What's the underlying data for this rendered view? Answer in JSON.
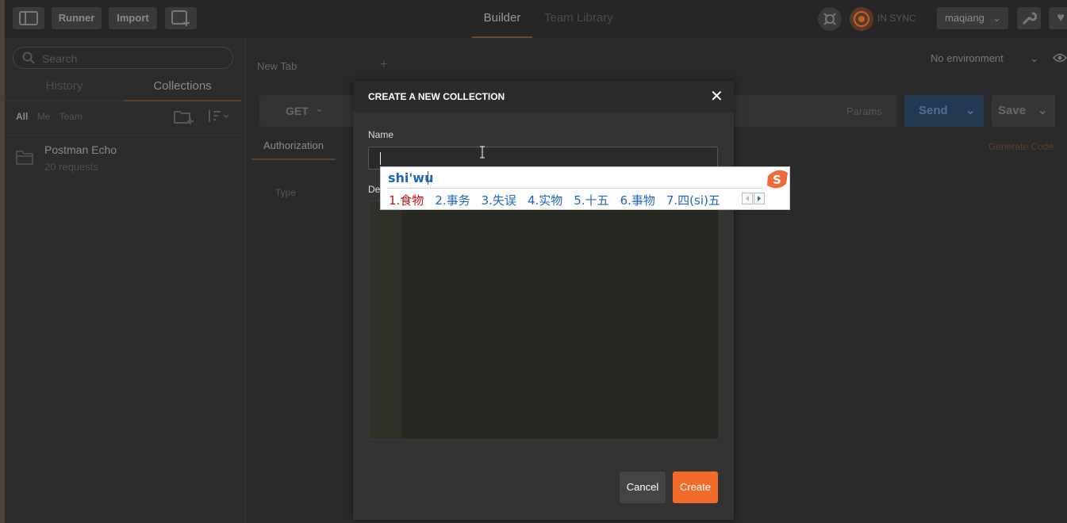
{
  "topbar": {
    "runner": "Runner",
    "import": "Import",
    "tabs": [
      "Builder",
      "Team Library"
    ],
    "sync": "IN SYNC",
    "user": "maqiang"
  },
  "sidebar": {
    "search_placeholder": "Search",
    "tabs": [
      "History",
      "Collections"
    ],
    "filters": [
      "All",
      "Me",
      "Team"
    ],
    "collection": {
      "name": "Postman Echo",
      "count": "20 requests"
    }
  },
  "main": {
    "tab_label": "New Tab",
    "add_tab": "+",
    "environment": "No environment",
    "method": "GET",
    "params": "Params",
    "send": "Send",
    "save": "Save",
    "auth_tab": "Authorization",
    "generate_code": "Generate Code",
    "type_label": "Type"
  },
  "modal": {
    "title": "CREATE A NEW COLLECTION",
    "close": "✕",
    "name_label": "Name",
    "desc_label": "De",
    "cancel": "Cancel",
    "create": "Create"
  },
  "ime": {
    "input": "shi'wu",
    "candidates": [
      "1.食物",
      "2.事务",
      "3.失误",
      "4.实物",
      "5.十五",
      "6.事物",
      "7.四(si)五"
    ]
  },
  "colors": {
    "accent": "#f26b28",
    "send_bg": "#243a52",
    "ime_blue": "#2266bb",
    "ime_red": "#cc1111"
  }
}
